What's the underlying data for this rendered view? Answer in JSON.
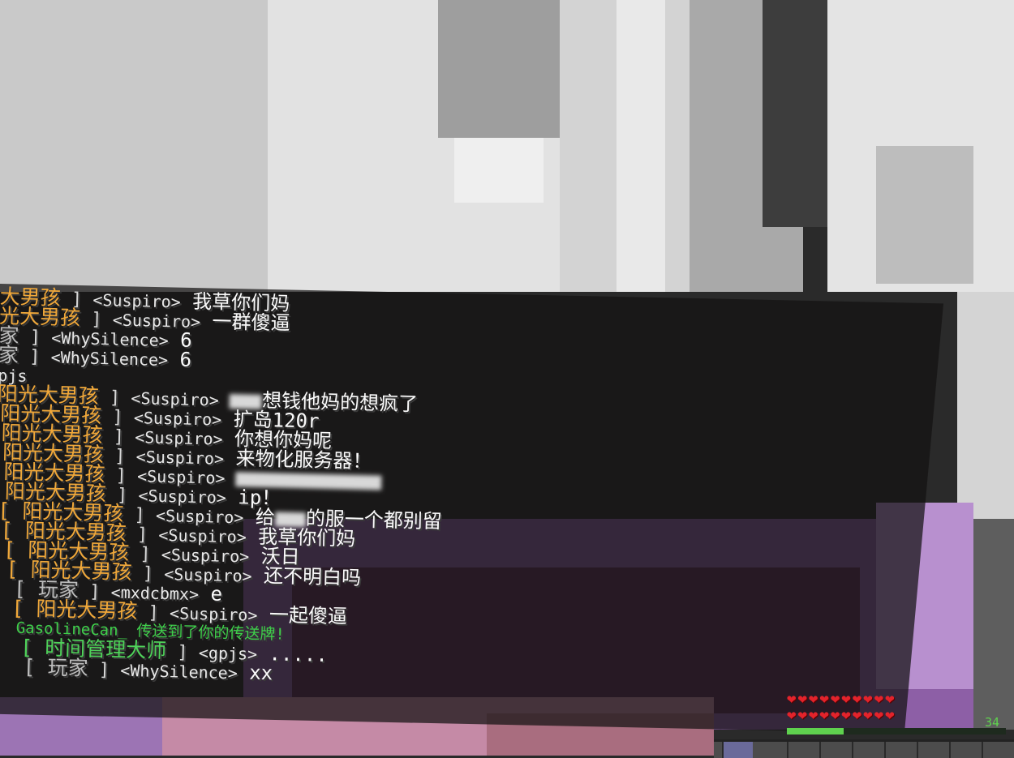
{
  "chat": {
    "lines": [
      {
        "rank": "大男孩",
        "bracket": " ] ",
        "name": "<Suspiro>",
        "msg": " 我草你们妈"
      },
      {
        "rank": "光大男孩",
        "bracket": " ] ",
        "name": "<Suspiro>",
        "msg": " 一群傻逼"
      },
      {
        "rank": "家",
        "bracket": " ] ",
        "name": "<WhySilence>",
        "msg": " 6"
      },
      {
        "rank": "家",
        "bracket": " ] ",
        "name": "<WhySilence>",
        "msg": " 6"
      },
      {
        "rank": "",
        "bracket": "",
        "name": "pjs",
        "msg": ""
      },
      {
        "rank": "阳光大男孩",
        "bracket": " ] ",
        "name": "<Suspiro>",
        "msg": "想钱他妈的想疯了"
      },
      {
        "rank": "阳光大男孩",
        "bracket": " ] ",
        "name": "<Suspiro>",
        "msg": " 扩岛120r"
      },
      {
        "rank": "阳光大男孩",
        "bracket": " ] ",
        "name": "<Suspiro>",
        "msg": " 你想你妈呢"
      },
      {
        "rank": "阳光大男孩",
        "bracket": " ] ",
        "name": "<Suspiro>",
        "msg": " 来物化服务器！"
      },
      {
        "rank": "阳光大男孩",
        "bracket": " ] ",
        "name": "<Suspiro>",
        "msg": ""
      },
      {
        "rank": "阳光大男孩",
        "bracket": " ] ",
        "name": "<Suspiro>",
        "msg": " ip！"
      },
      {
        "rank": "[ 阳光大男孩",
        "bracket": " ] ",
        "name": "<Suspiro>",
        "msg": " 给"
      },
      {
        "rank": "[ 阳光大男孩",
        "bracket": " ] ",
        "name": "<Suspiro>",
        "msg": " 我草你们妈"
      },
      {
        "rank": "[ 阳光大男孩",
        "bracket": " ] ",
        "name": "<Suspiro>",
        "msg": " 沃日"
      },
      {
        "rank": "[ 阳光大男孩",
        "bracket": " ] ",
        "name": "<Suspiro>",
        "msg": " 还不明白吗"
      },
      {
        "rank": "[ 玩家",
        "bracket": " ] ",
        "name": "<mxdcbmx>",
        "msg": " e"
      },
      {
        "rank": "[ 阳光大男孩",
        "bracket": " ] ",
        "name": "<Suspiro>",
        "msg": " 一起傻逼"
      },
      {
        "rank": "",
        "bracket": "",
        "name": "",
        "msg": "GasolineCan_ 传送到了你的传送牌!"
      },
      {
        "rank": "[ 时间管理大师",
        "bracket": " ] ",
        "name": "<gpjs>",
        "msg": " ....."
      },
      {
        "rank": "[ 玩家",
        "bracket": " ] ",
        "name": "<WhySilence>",
        "msg": " xx"
      }
    ],
    "line12_suffix": "的服一个都别留"
  },
  "hud": {
    "level": "34",
    "hearts_row1": 10,
    "hearts_row2": 10,
    "xp_fraction": 0.26,
    "heart_color": "#e3232b",
    "xp_color": "#5fd24e"
  }
}
